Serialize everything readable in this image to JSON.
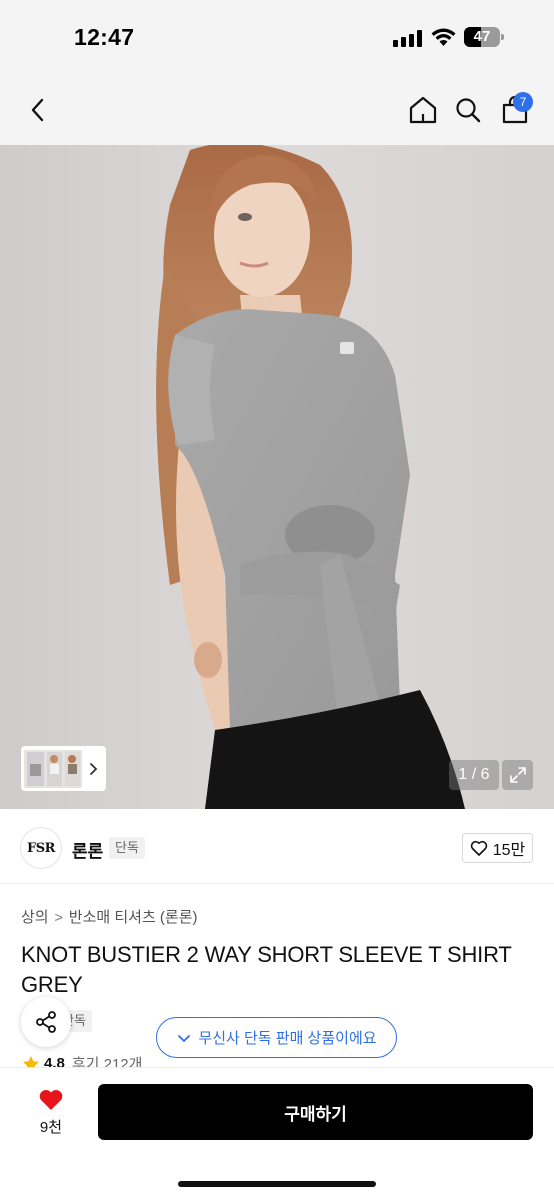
{
  "status": {
    "time": "12:47",
    "battery": "47",
    "battery_level": 0.47
  },
  "nav": {
    "back_icon": "chevron-left-icon",
    "home_icon": "home-icon",
    "search_icon": "search-icon",
    "cart_icon": "shopping-bag-icon",
    "cart_count": "7"
  },
  "gallery": {
    "counter": "1 / 6",
    "expand_icon": "expand-icon"
  },
  "brand": {
    "logo_text": "FSR",
    "name": "론론",
    "tag": "단독",
    "like_count": "15만"
  },
  "product": {
    "breadcrumb": [
      "상의",
      "반소매 티셔츠 (론론)"
    ],
    "title": "KNOT BUSTIER 2 WAY SHORT SLEEVE T SHIRT GREY",
    "exclusive_tag": "단독",
    "rating": "4.8",
    "review_count": "후기 212개"
  },
  "toast": {
    "text": "무신사 단독 판매 상품이에요"
  },
  "bottom": {
    "wish_count": "9천",
    "buy_label": "구매하기"
  },
  "colors": {
    "accent": "#2f6fe9",
    "heart": "#e8141b",
    "buy_button": "#000000"
  }
}
